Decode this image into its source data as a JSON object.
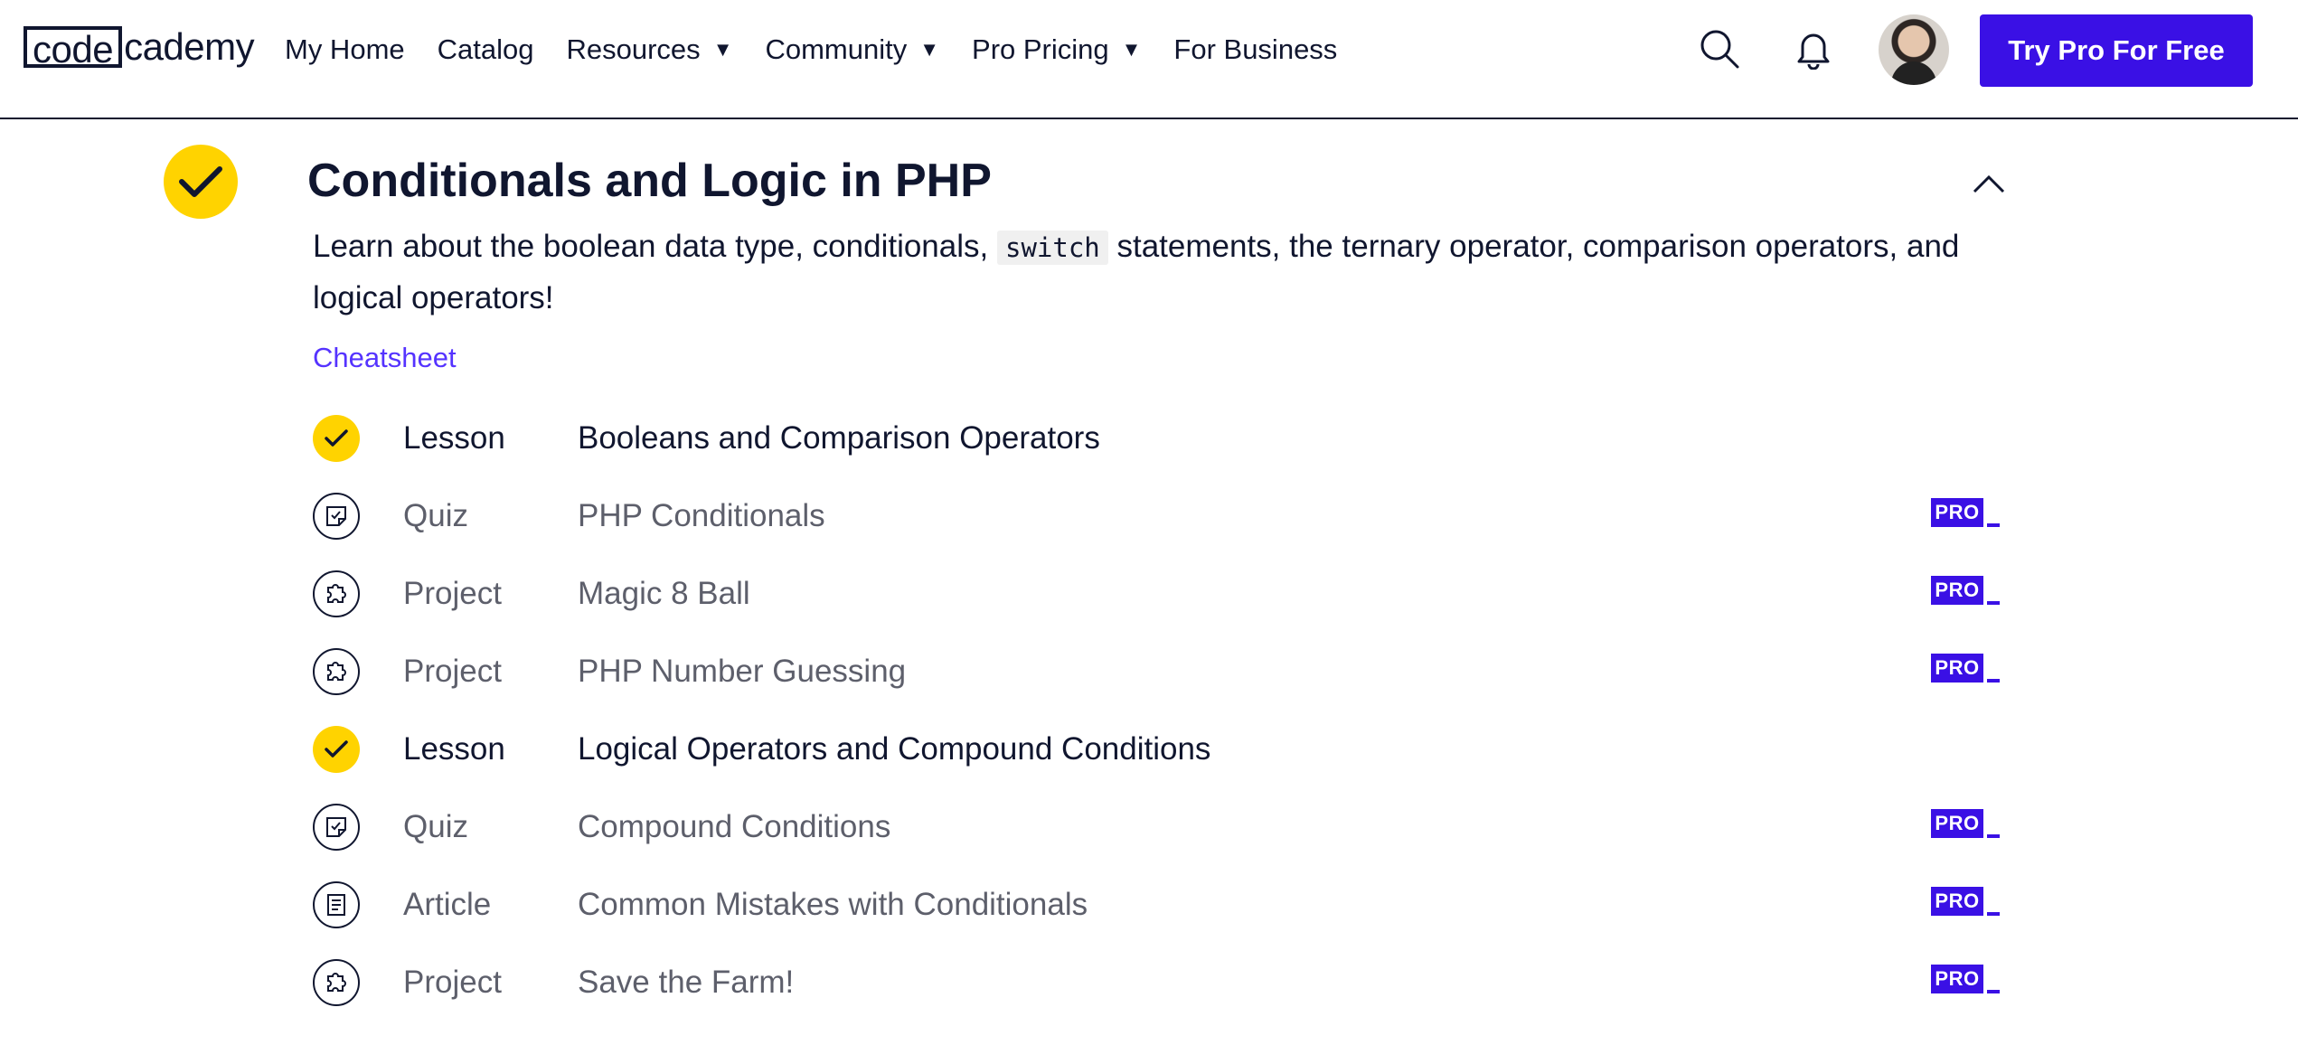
{
  "header": {
    "logo": {
      "part1": "code",
      "part2": "cademy"
    },
    "nav": [
      {
        "label": "My Home",
        "dropdown": false
      },
      {
        "label": "Catalog",
        "dropdown": false
      },
      {
        "label": "Resources",
        "dropdown": true
      },
      {
        "label": "Community",
        "dropdown": true
      },
      {
        "label": "Pro Pricing",
        "dropdown": true
      },
      {
        "label": "For Business",
        "dropdown": false
      }
    ],
    "icons": [
      "search-icon",
      "bell-icon"
    ],
    "cta_label": "Try Pro For Free"
  },
  "module": {
    "title": "Conditionals and Logic in PHP",
    "completed": true,
    "description_before": "Learn about the boolean data type, conditionals,",
    "description_code": "switch",
    "description_after": "statements, the ternary operator, comparison operators, and logical operators!",
    "cheatsheet_label": "Cheatsheet",
    "items": [
      {
        "type": "Lesson",
        "title": "Booleans and Comparison Operators",
        "status": "completed",
        "icon": "check-icon",
        "pro": false
      },
      {
        "type": "Quiz",
        "title": "PHP Conditionals",
        "status": "locked",
        "icon": "quiz-icon",
        "pro": true
      },
      {
        "type": "Project",
        "title": "Magic 8 Ball",
        "status": "locked",
        "icon": "puzzle-icon",
        "pro": true
      },
      {
        "type": "Project",
        "title": "PHP Number Guessing",
        "status": "locked",
        "icon": "puzzle-icon",
        "pro": true
      },
      {
        "type": "Lesson",
        "title": "Logical Operators and Compound Conditions",
        "status": "completed",
        "icon": "check-icon",
        "pro": false
      },
      {
        "type": "Quiz",
        "title": "Compound Conditions",
        "status": "locked",
        "icon": "quiz-icon",
        "pro": true
      },
      {
        "type": "Article",
        "title": "Common Mistakes with Conditionals",
        "status": "locked",
        "icon": "article-icon",
        "pro": true
      },
      {
        "type": "Project",
        "title": "Save the Farm!",
        "status": "locked",
        "icon": "puzzle-icon",
        "pro": true
      }
    ],
    "pro_badge_label": "PRO"
  },
  "colors": {
    "accent": "#3a10e5",
    "check": "#ffd300",
    "text": "#10162f",
    "muted": "#5d5f6b",
    "link": "#5533ff"
  }
}
